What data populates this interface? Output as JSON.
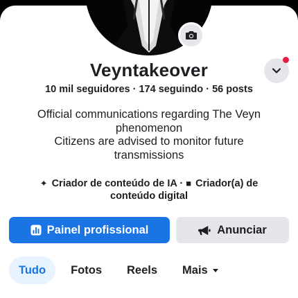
{
  "profile": {
    "name": "Veyntakeover",
    "followers": "10 mil seguidores",
    "following": "174 seguindo",
    "posts": "56 posts",
    "separator": "·",
    "bio_lines": [
      "Official communications regarding The Veyn",
      "phenomenon",
      "Citizens are advised to monitor future",
      "transmissions"
    ],
    "category_1": "Criador de conteúdo de IA",
    "category_2": "Criador(a) de conteúdo digital",
    "category_sep": "·"
  },
  "actions": {
    "primary_label": "Painel profissional",
    "secondary_label": "Anunciar"
  },
  "tabs": [
    {
      "label": "Tudo",
      "active": true
    },
    {
      "label": "Fotos",
      "active": false
    },
    {
      "label": "Reels",
      "active": false
    },
    {
      "label": "Mais",
      "active": false
    }
  ],
  "colors": {
    "accent": "#1b74e4",
    "secondary_bg": "#e4e6eb",
    "tab_active_bg": "#e7f3ff",
    "notification": "#e41e3f"
  },
  "icons": {
    "camera": "camera-icon",
    "chevron": "chevron-down-icon",
    "sparkle": "sparkle-icon",
    "video": "video-icon",
    "dashboard": "dashboard-icon",
    "megaphone": "megaphone-icon",
    "caret": "caret-down-icon"
  }
}
